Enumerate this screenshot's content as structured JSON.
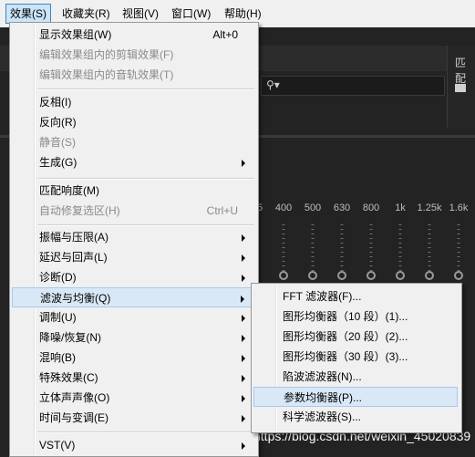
{
  "menubar": {
    "items": [
      {
        "label": "效果(S)",
        "active": true
      },
      {
        "label": "收藏夹(R)"
      },
      {
        "label": "视图(V)"
      },
      {
        "label": "窗口(W)"
      },
      {
        "label": "帮助(H)"
      }
    ]
  },
  "background": {
    "right_panel_title": "匹配",
    "frequencies": [
      "5",
      "400",
      "500",
      "630",
      "800",
      "1k",
      "1.25k",
      "1.6k"
    ],
    "bottom_text": "3 dB"
  },
  "effects_menu": {
    "items": [
      {
        "label": "显示效果组(W)",
        "shortcut": "Alt+0"
      },
      {
        "label": "编辑效果组内的剪辑效果(F)",
        "disabled": true
      },
      {
        "label": "编辑效果组内的音轨效果(T)",
        "disabled": true
      },
      {
        "label": "反相(I)"
      },
      {
        "label": "反向(R)"
      },
      {
        "label": "静音(S)",
        "disabled": true
      },
      {
        "label": "生成(G)",
        "submenu": true
      },
      {
        "label": "匹配响度(M)"
      },
      {
        "label": "自动修复选区(H)",
        "shortcut": "Ctrl+U",
        "disabled": true
      },
      {
        "label": "振幅与压限(A)",
        "submenu": true
      },
      {
        "label": "延迟与回声(L)",
        "submenu": true
      },
      {
        "label": "诊断(D)",
        "submenu": true
      },
      {
        "label": "滤波与均衡(Q)",
        "submenu": true,
        "highlighted": true
      },
      {
        "label": "调制(U)",
        "submenu": true
      },
      {
        "label": "降噪/恢复(N)",
        "submenu": true
      },
      {
        "label": "混响(B)",
        "submenu": true
      },
      {
        "label": "特殊效果(C)",
        "submenu": true
      },
      {
        "label": "立体声声像(O)",
        "submenu": true
      },
      {
        "label": "时间与变调(E)",
        "submenu": true
      },
      {
        "label": "VST(V)",
        "submenu": true
      }
    ]
  },
  "filter_submenu": {
    "items": [
      {
        "label": "FFT 滤波器(F)..."
      },
      {
        "label": "图形均衡器（10 段）(1)..."
      },
      {
        "label": "图形均衡器（20 段）(2)..."
      },
      {
        "label": "图形均衡器（30 段）(3)..."
      },
      {
        "label": "陷波滤波器(N)..."
      },
      {
        "label": "参数均衡器(P)...",
        "highlighted": true
      },
      {
        "label": "科学滤波器(S)..."
      }
    ]
  },
  "watermark": "https://blog.csdn.net/weixin_45020839",
  "colors": {
    "menu_bg": "#f0f0f0",
    "highlight": "#d9e8f6",
    "app_bg": "#232323"
  }
}
